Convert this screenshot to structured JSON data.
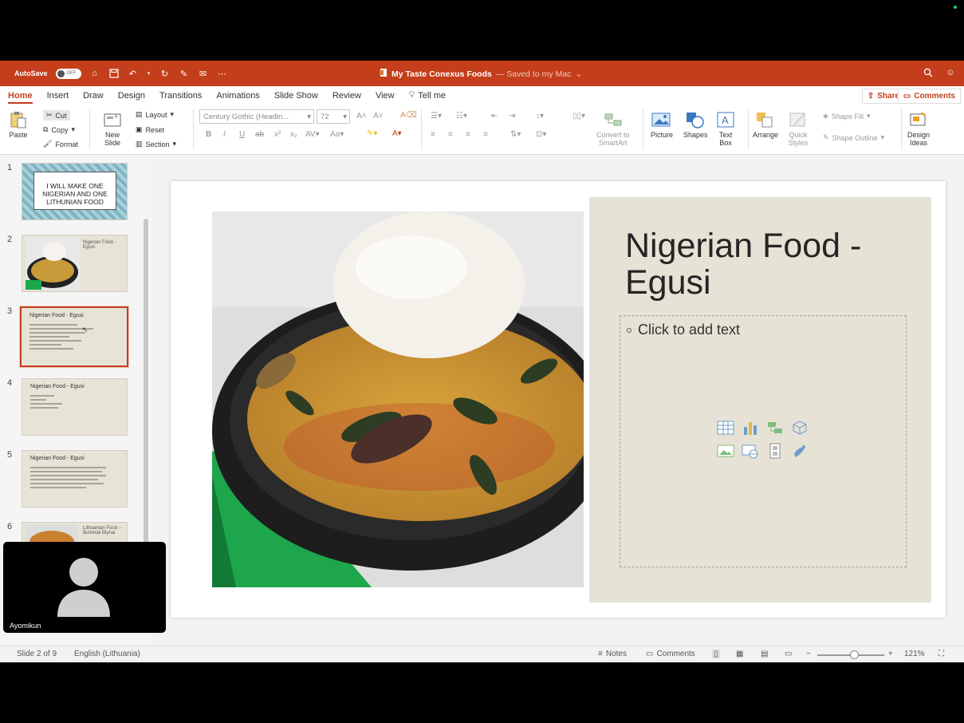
{
  "titlebar": {
    "autosave_label": "AutoSave",
    "autosave_state": "OFF",
    "doc_name": "My Taste Conexus Foods",
    "saved_status": "— Saved to my Mac"
  },
  "tabs": [
    "Home",
    "Insert",
    "Draw",
    "Design",
    "Transitions",
    "Animations",
    "Slide Show",
    "Review",
    "View"
  ],
  "tell_me": "Tell me",
  "share_label": "Share",
  "comments_label": "Comments",
  "ribbon": {
    "paste": "Paste",
    "cut": "Cut",
    "copy": "Copy",
    "format": "Format",
    "new_slide_line1": "New",
    "new_slide_line2": "Slide",
    "layout": "Layout",
    "reset": "Reset",
    "section": "Section",
    "font_name": "Century Gothic (Headin...",
    "font_size": "72",
    "convert_line1": "Convert to",
    "convert_line2": "SmartArt",
    "picture": "Picture",
    "shapes": "Shapes",
    "textbox_line1": "Text",
    "textbox_line2": "Box",
    "arrange": "Arrange",
    "quick_line1": "Quick",
    "quick_line2": "Styles",
    "shape_fill": "Shape Fill",
    "shape_outline": "Shape Outline",
    "design_line1": "Design",
    "design_line2": "Ideas"
  },
  "thumbnails": [
    {
      "num": "1",
      "text": "I WILL MAKE ONE NIGERIAN AND ONE LITHUNIAN FOOD"
    },
    {
      "num": "2",
      "text": "Nigerian Food - Egusi"
    },
    {
      "num": "3",
      "text": "Nigerian Food - Egusi"
    },
    {
      "num": "4",
      "text": "Nigerian Food - Egusi"
    },
    {
      "num": "5",
      "text": "Nigerian Food - Egusi"
    },
    {
      "num": "6",
      "text": "Lithuanian Food – Bulviniai Blynai"
    }
  ],
  "slide": {
    "title": "Nigerian Food - Egusi",
    "placeholder": "Click to add text"
  },
  "video": {
    "name": "Ayomikun"
  },
  "status": {
    "slide_info": "Slide 2 of 9",
    "language": "English (Lithuania)",
    "notes": "Notes",
    "comments": "Comments",
    "zoom": "121%"
  },
  "zoom_level": 0.55,
  "colors": {
    "accent": "#c43e1c",
    "panel": "#e6e2d5"
  }
}
